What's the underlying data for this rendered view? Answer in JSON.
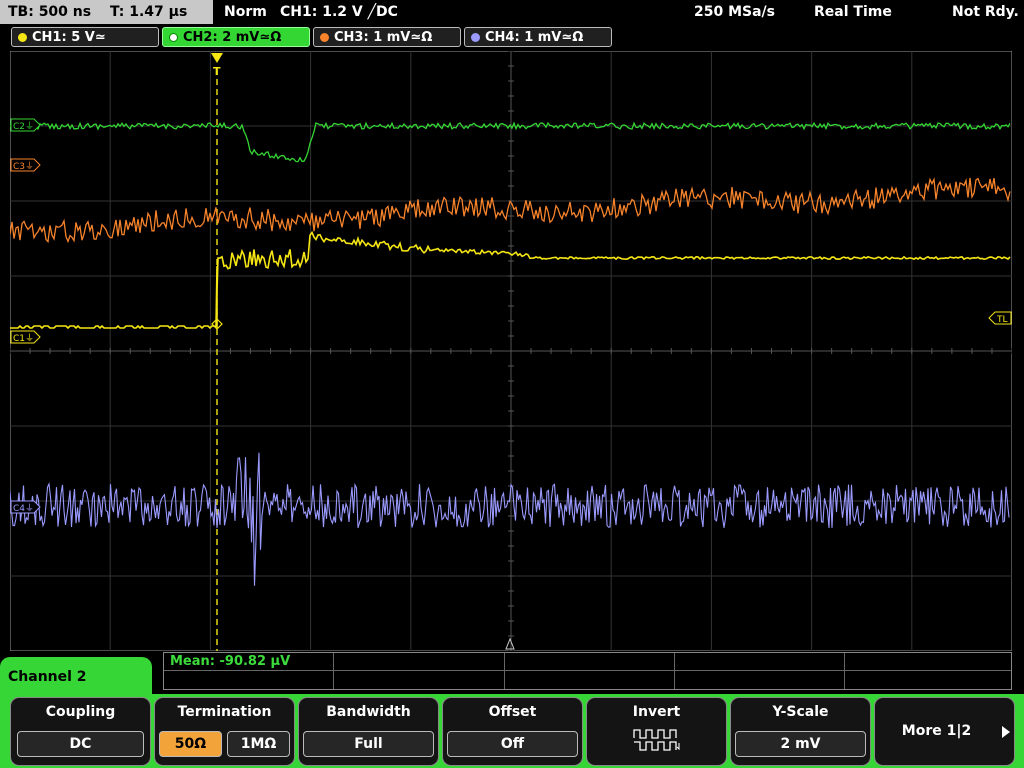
{
  "status": {
    "timebase": "TB: 500 ns",
    "trigger_time": "T: 1.47 µs",
    "trigger_mode": "Norm",
    "trigger_settings": "CH1: 1.2 V ╱DC",
    "sample_rate": "250 MSa/s",
    "acq_mode": "Real Time",
    "acq_state": "Not Rdy."
  },
  "channels": [
    {
      "label": "CH1: 5 V≃",
      "color": "#f5e614",
      "active": false
    },
    {
      "label": "CH2: 2 mV≃Ω",
      "color": "#34d634",
      "active": true
    },
    {
      "label": "CH3: 1 mV≃Ω",
      "color": "#f7832b",
      "active": false
    },
    {
      "label": "CH4: 1 mV≃Ω",
      "color": "#9a9aff",
      "active": false
    }
  ],
  "markers": {
    "c1": "C1⏚",
    "c2": "C2⏚",
    "c3": "C3⏚",
    "c4": "C4⏚",
    "tl": "TL",
    "trigger": "T"
  },
  "measurement": {
    "mean": "Mean: -90.82 µV"
  },
  "menu": {
    "title": "Channel 2",
    "accent_color": "#37d637",
    "coupling": {
      "label": "Coupling",
      "value": "DC"
    },
    "termination": {
      "label": "Termination",
      "options": [
        "50Ω",
        "1MΩ"
      ],
      "selected": 0
    },
    "bandwidth": {
      "label": "Bandwidth",
      "value": "Full"
    },
    "offset": {
      "label": "Offset",
      "value": "Off"
    },
    "invert": {
      "label": "Invert"
    },
    "yscale": {
      "label": "Y-Scale",
      "value": "2 mV"
    },
    "more": {
      "label": "More 1|2"
    }
  }
}
